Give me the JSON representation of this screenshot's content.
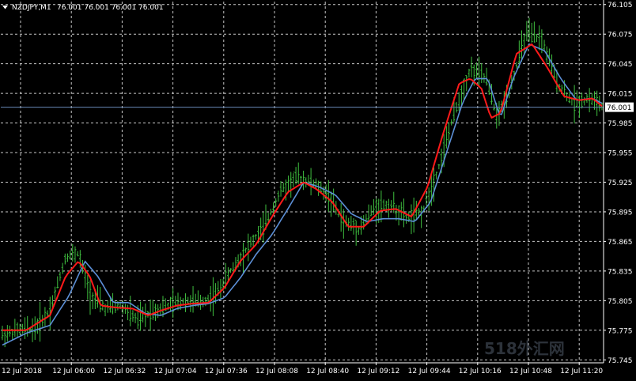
{
  "chart_title": {
    "symbol_label": "NZDJPY,M1",
    "ohlc_label": "76.001 76.001 76.001 76.001",
    "arrow_icon": "triangle-down-icon"
  },
  "current_price": "76.001",
  "watermark_text": "518外汇网",
  "colors": {
    "background": "#000000",
    "grid": "#c8c8c8",
    "bars": "#3fbf3f",
    "ma_fast": "#ff1a1a",
    "ma_slow": "#5c8fd6",
    "price_line": "#6a8ab8",
    "price_tag_bg": "#ffffff",
    "axis_text": "#ffffff"
  },
  "chart_data": {
    "type": "ohlc-bars",
    "symbol": "NZDJPY",
    "timeframe": "M1",
    "x_tick_labels": [
      "12 Jul 2018",
      "12 Jul 06:00",
      "12 Jul 06:32",
      "12 Jul 07:04",
      "12 Jul 07:36",
      "12 Jul 08:08",
      "12 Jul 08:40",
      "12 Jul 09:12",
      "12 Jul 09:44",
      "12 Jul 10:16",
      "12 Jul 10:48",
      "12 Jul 11:20"
    ],
    "y_tick_labels": [
      "76.105",
      "76.075",
      "76.045",
      "76.015",
      "75.985",
      "75.955",
      "75.925",
      "75.895",
      "75.865",
      "75.835",
      "75.805",
      "75.775",
      "75.745"
    ],
    "ylim": [
      75.742,
      76.108
    ],
    "bar_count": 240,
    "close_path": [
      [
        0,
        75.77
      ],
      [
        10,
        75.775
      ],
      [
        20,
        75.776
      ],
      [
        30,
        75.795
      ],
      [
        40,
        75.85
      ],
      [
        48,
        75.853
      ],
      [
        55,
        75.812
      ],
      [
        65,
        75.797
      ],
      [
        75,
        75.8
      ],
      [
        85,
        75.785
      ],
      [
        95,
        75.795
      ],
      [
        105,
        75.8
      ],
      [
        115,
        75.805
      ],
      [
        125,
        75.803
      ],
      [
        135,
        75.812
      ],
      [
        145,
        75.838
      ],
      [
        155,
        75.86
      ],
      [
        165,
        75.88
      ],
      [
        175,
        75.915
      ],
      [
        185,
        75.93
      ],
      [
        195,
        75.925
      ],
      [
        205,
        75.913
      ],
      [
        215,
        75.885
      ],
      [
        225,
        75.878
      ],
      [
        235,
        75.9
      ],
      [
        245,
        75.902
      ],
      [
        255,
        75.888
      ],
      [
        265,
        75.895
      ],
      [
        275,
        75.94
      ],
      [
        285,
        75.995
      ],
      [
        295,
        76.04
      ],
      [
        305,
        76.03
      ],
      [
        312,
        75.99
      ],
      [
        320,
        76.02
      ],
      [
        330,
        76.075
      ],
      [
        340,
        76.07
      ],
      [
        350,
        76.025
      ],
      [
        360,
        76.005
      ],
      [
        370,
        76.01
      ],
      [
        378,
        76.002
      ]
    ],
    "ma_fast_path": [
      [
        0,
        75.775
      ],
      [
        15,
        75.775
      ],
      [
        30,
        75.79
      ],
      [
        40,
        75.83
      ],
      [
        48,
        75.845
      ],
      [
        55,
        75.83
      ],
      [
        62,
        75.8
      ],
      [
        72,
        75.798
      ],
      [
        82,
        75.797
      ],
      [
        92,
        75.79
      ],
      [
        100,
        75.795
      ],
      [
        110,
        75.8
      ],
      [
        120,
        75.802
      ],
      [
        130,
        75.803
      ],
      [
        140,
        75.818
      ],
      [
        150,
        75.845
      ],
      [
        160,
        75.862
      ],
      [
        170,
        75.89
      ],
      [
        180,
        75.915
      ],
      [
        190,
        75.925
      ],
      [
        198,
        75.918
      ],
      [
        208,
        75.905
      ],
      [
        218,
        75.88
      ],
      [
        228,
        75.88
      ],
      [
        238,
        75.896
      ],
      [
        248,
        75.898
      ],
      [
        258,
        75.89
      ],
      [
        268,
        75.92
      ],
      [
        278,
        75.975
      ],
      [
        288,
        76.025
      ],
      [
        295,
        76.03
      ],
      [
        302,
        76.02
      ],
      [
        308,
        75.99
      ],
      [
        314,
        75.995
      ],
      [
        324,
        76.055
      ],
      [
        334,
        76.065
      ],
      [
        344,
        76.04
      ],
      [
        354,
        76.012
      ],
      [
        364,
        76.008
      ],
      [
        372,
        76.01
      ],
      [
        378,
        76.002
      ]
    ],
    "ma_slow_path": [
      [
        0,
        75.76
      ],
      [
        15,
        75.772
      ],
      [
        30,
        75.78
      ],
      [
        42,
        75.81
      ],
      [
        52,
        75.845
      ],
      [
        60,
        75.83
      ],
      [
        70,
        75.803
      ],
      [
        80,
        75.803
      ],
      [
        90,
        75.792
      ],
      [
        100,
        75.79
      ],
      [
        110,
        75.797
      ],
      [
        120,
        75.8
      ],
      [
        130,
        75.802
      ],
      [
        140,
        75.808
      ],
      [
        150,
        75.828
      ],
      [
        160,
        75.852
      ],
      [
        170,
        75.872
      ],
      [
        180,
        75.898
      ],
      [
        190,
        75.925
      ],
      [
        200,
        75.92
      ],
      [
        210,
        75.912
      ],
      [
        220,
        75.893
      ],
      [
        230,
        75.885
      ],
      [
        240,
        75.888
      ],
      [
        250,
        75.888
      ],
      [
        260,
        75.885
      ],
      [
        270,
        75.905
      ],
      [
        280,
        75.955
      ],
      [
        290,
        76.005
      ],
      [
        298,
        76.03
      ],
      [
        306,
        76.03
      ],
      [
        314,
        75.99
      ],
      [
        322,
        76.03
      ],
      [
        332,
        76.065
      ],
      [
        342,
        76.058
      ],
      [
        352,
        76.03
      ],
      [
        362,
        76.008
      ],
      [
        372,
        76.01
      ],
      [
        378,
        76.005
      ]
    ]
  }
}
